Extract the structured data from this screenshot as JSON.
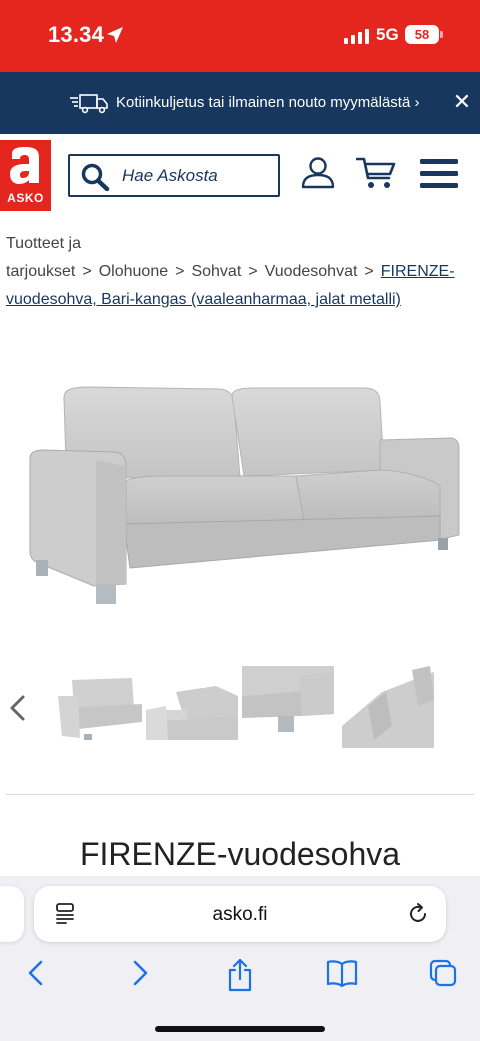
{
  "status": {
    "time": "13.34",
    "network": "5G",
    "battery": "58"
  },
  "promo": {
    "text": "Kotiinkuljetus tai ilmainen nouto myymälästä ›"
  },
  "header": {
    "logo_text": "ASKO",
    "search_placeholder": "Hae Askosta"
  },
  "breadcrumb": {
    "items": [
      "Tuotteet ja tarjoukset",
      "Olohuone",
      "Sohvat",
      "Vuodesohvat"
    ],
    "separator": ">",
    "current": "FIRENZE-vuodesohva, Bari-kangas (vaaleanharmaa, jalat metalli)"
  },
  "product": {
    "title": "FIRENZE-vuodesohva"
  },
  "browser": {
    "url": "asko.fi"
  },
  "colors": {
    "brand_red": "#e5261e",
    "navy": "#17375e",
    "ios_blue": "#1a73e8"
  }
}
